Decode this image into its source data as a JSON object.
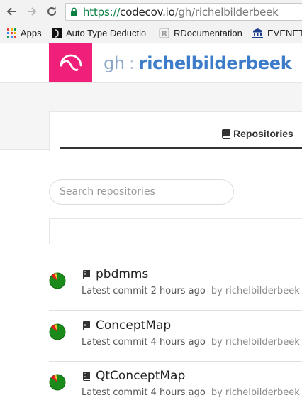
{
  "browser": {
    "url_scheme": "https://",
    "url_host": "codecov.io",
    "url_path": "/gh/richelbilderbeek",
    "bookmarks": [
      {
        "label": "Apps",
        "icon": "apps-grid-icon"
      },
      {
        "label": "Auto Type Deductio",
        "icon": "page-favicon"
      },
      {
        "label": "RDocumentation",
        "icon": "r-logo-icon"
      },
      {
        "label": "EVENET",
        "icon": "institution-icon"
      }
    ]
  },
  "header": {
    "service": "gh",
    "separator": ":",
    "owner": "richelbilderbeek",
    "brand_color": "#f01f7a"
  },
  "tabs": {
    "active_label": "Repositories"
  },
  "search": {
    "placeholder": "Search repositories"
  },
  "repos": [
    {
      "name": "pbdmms",
      "commit": "Latest commit 2 hours ago",
      "author": "by richelbilderbeek",
      "coverage_color": "#1a8a1a"
    },
    {
      "name": "ConceptMap",
      "commit": "Latest commit 4 hours ago",
      "author": "by richelbilderbeek",
      "coverage_color": "#1a8a1a"
    },
    {
      "name": "QtConceptMap",
      "commit": "Latest commit 4 hours ago",
      "author": "by richelbilderbeek",
      "coverage_color": "#1a8a1a"
    }
  ]
}
